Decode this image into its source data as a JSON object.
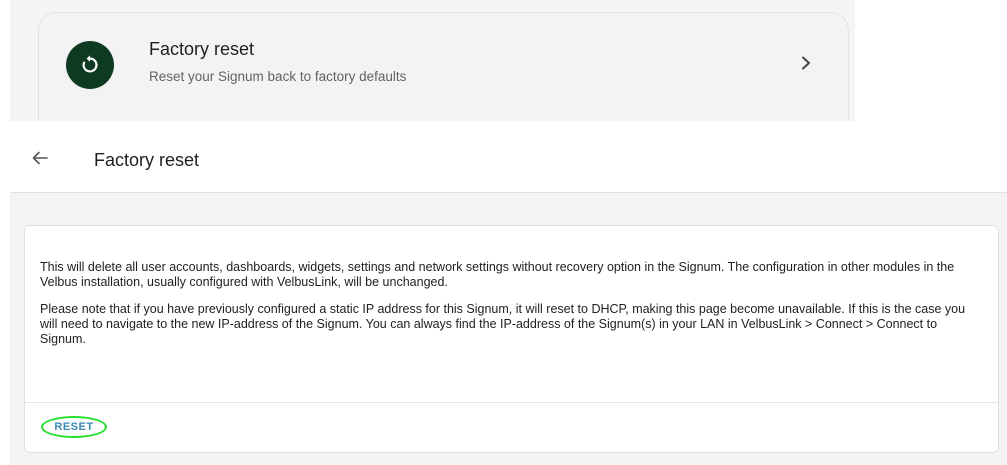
{
  "settings_item": {
    "title": "Factory reset",
    "description": "Reset your Signum back to factory defaults",
    "icon": "restart-icon",
    "icon_bg": "#0e3a22"
  },
  "header": {
    "title": "Factory reset"
  },
  "card": {
    "paragraph1": "This will delete all user accounts, dashboards, widgets, settings and network settings without recovery option in the Signum. The configuration in other modules in the Velbus installation, usually configured with VelbusLink, will be unchanged.",
    "paragraph2": "Please note that if you have previously configured a static IP address for this Signum, it will reset to DHCP, making this page become unavailable. If this is the case you will need to navigate to the new IP-address of the Signum. You can always find the IP-address of the Signum(s) in your LAN in VelbusLink > Connect > Connect to Signum.",
    "reset_label": "RESET"
  },
  "colors": {
    "accent_text": "#3a8bb5",
    "highlight_ring": "#23e02a"
  }
}
